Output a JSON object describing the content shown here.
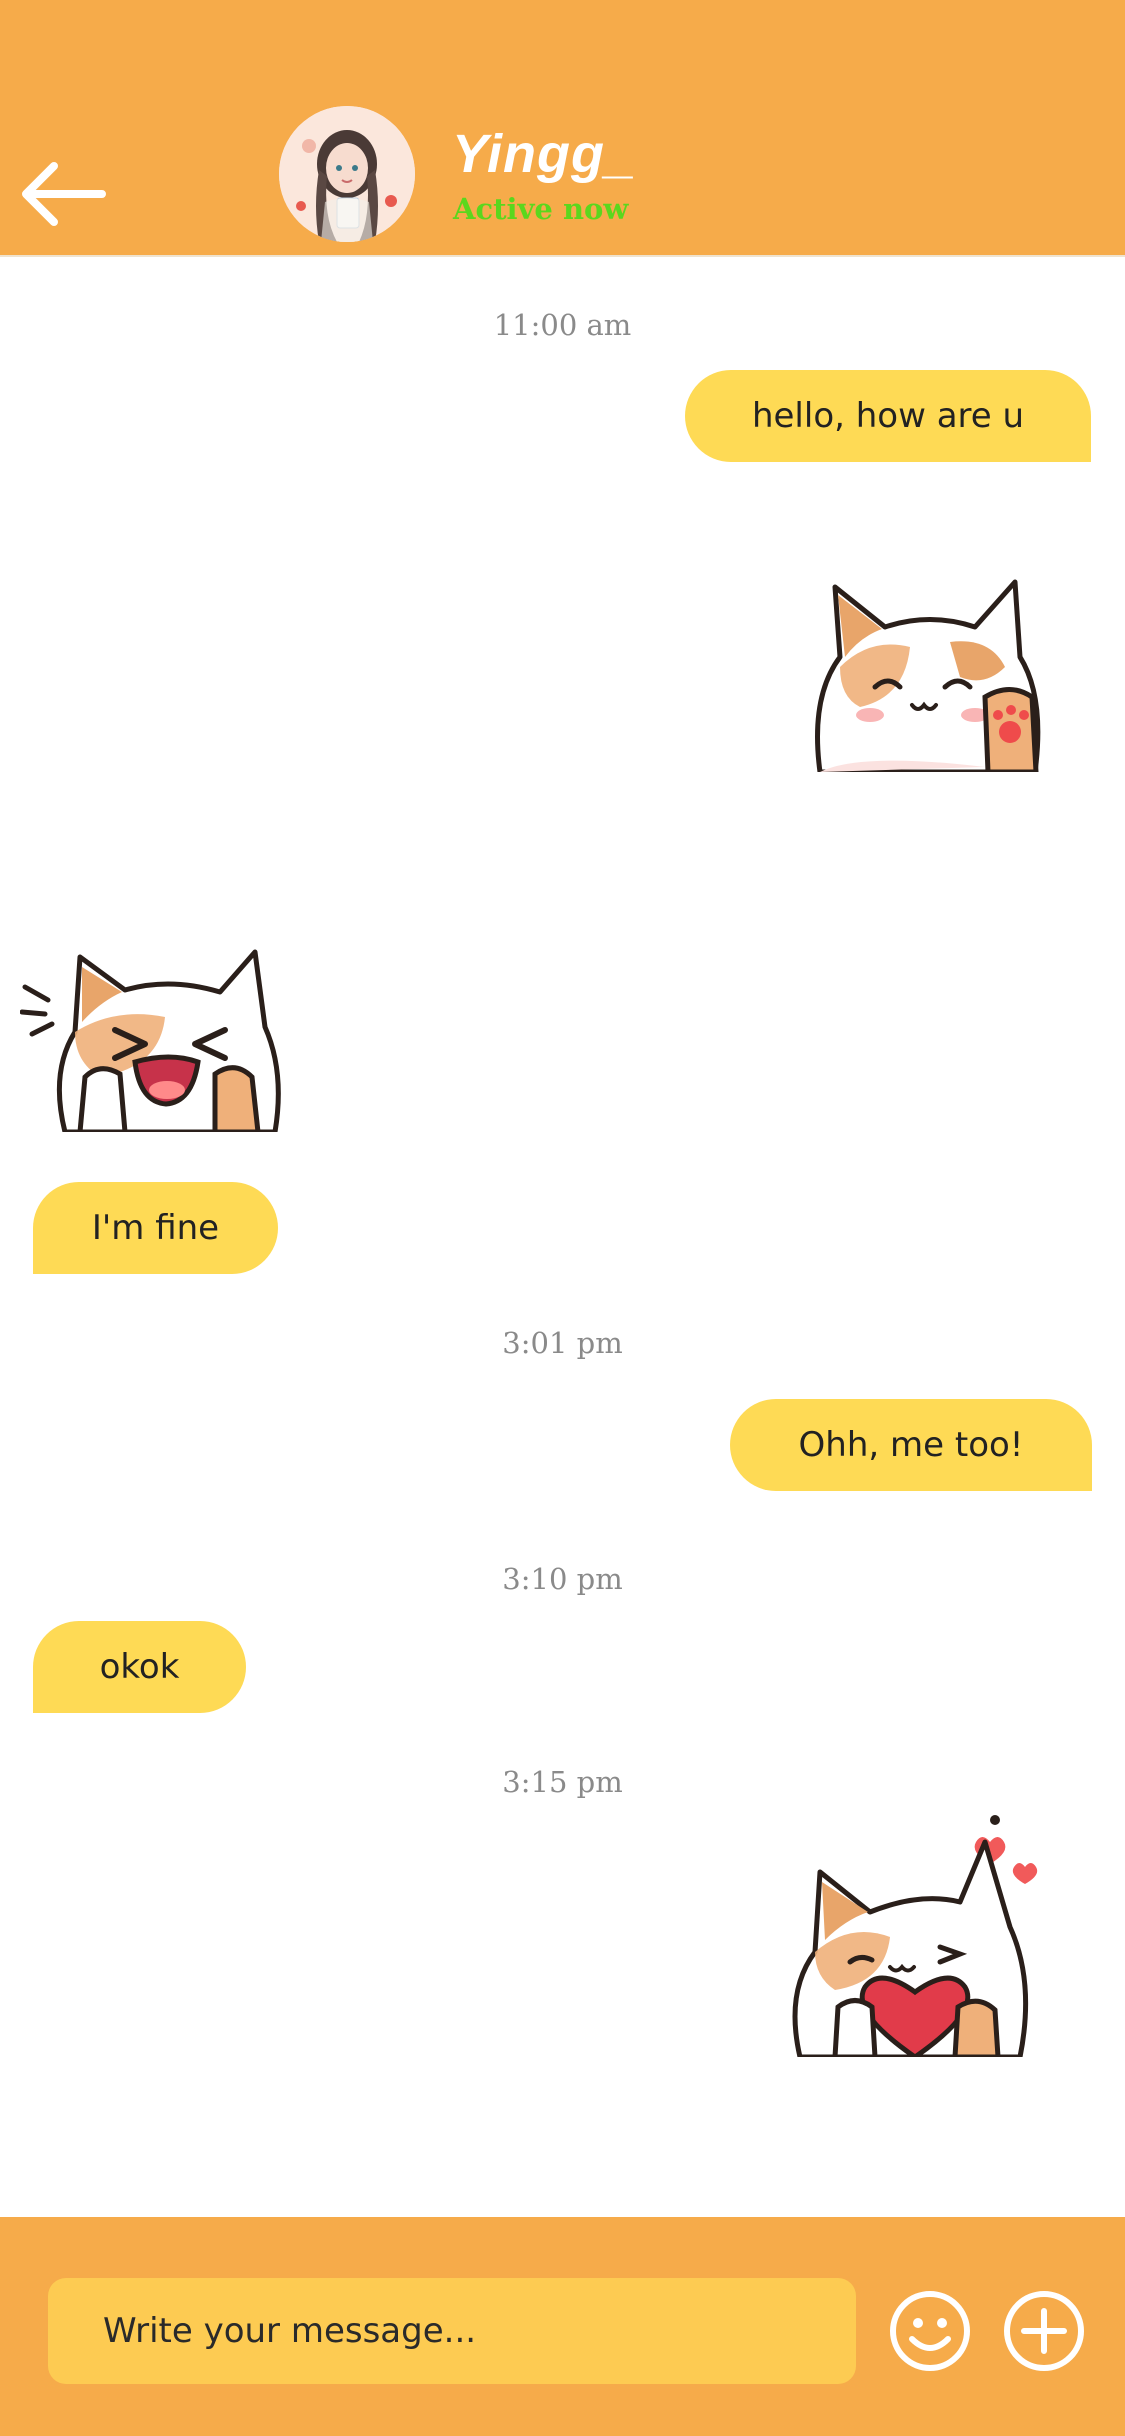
{
  "header": {
    "contact_name": "Yingg_",
    "status": "Active now",
    "back_icon": "arrow-left-icon"
  },
  "messages": [
    {
      "type": "timestamp",
      "text": "11:00 am"
    },
    {
      "type": "text",
      "direction": "outgoing",
      "text": "hello, how are u"
    },
    {
      "type": "sticker",
      "direction": "outgoing",
      "sticker": "cat-waving"
    },
    {
      "type": "sticker",
      "direction": "incoming",
      "sticker": "cat-excited"
    },
    {
      "type": "text",
      "direction": "incoming",
      "text": "I'm fine"
    },
    {
      "type": "timestamp",
      "text": "3:01 pm"
    },
    {
      "type": "text",
      "direction": "outgoing",
      "text": "Ohh, me too!"
    },
    {
      "type": "timestamp",
      "text": "3:10 pm"
    },
    {
      "type": "text",
      "direction": "incoming",
      "text": "okok"
    },
    {
      "type": "timestamp",
      "text": "3:15 pm"
    },
    {
      "type": "sticker",
      "direction": "outgoing",
      "sticker": "cat-heart"
    }
  ],
  "composer": {
    "placeholder": "Write your message...",
    "emoji_icon": "smiley-icon",
    "add_icon": "plus-icon"
  },
  "colors": {
    "header_bg": "#F6AB4A",
    "bubble": "#FEDA55",
    "input_bg": "#FDCB52",
    "status": "#5bd71d"
  }
}
